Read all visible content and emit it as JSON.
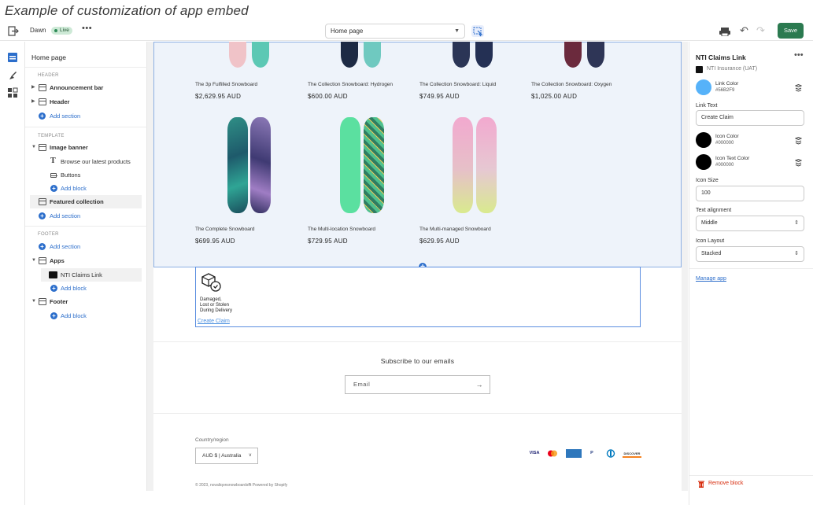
{
  "caption": "Example of customization of app embed",
  "topbar": {
    "theme_name": "Dawn",
    "live_badge": "Live",
    "more": "•••",
    "page_select": "Home page",
    "save_label": "Save"
  },
  "sidebar": {
    "title": "Home page",
    "header_group": "HEADER",
    "announcement_bar": "Announcement bar",
    "header": "Header",
    "add_section": "Add section",
    "template_group": "TEMPLATE",
    "image_banner": "Image banner",
    "browse_text": "Browse our latest products",
    "buttons": "Buttons",
    "add_block": "Add block",
    "featured_collection": "Featured collection",
    "footer_group": "FOOTER",
    "apps": "Apps",
    "nti_claims_link": "NTI Claims Link",
    "footer": "Footer"
  },
  "preview": {
    "products": [
      {
        "name": "The 3p Fulfilled Snowboard",
        "price": "$2,629.95 AUD"
      },
      {
        "name": "The Collection Snowboard: Hydrogen",
        "price": "$600.00 AUD"
      },
      {
        "name": "The Collection Snowboard: Liquid",
        "price": "$749.95 AUD"
      },
      {
        "name": "The Collection Snowboard: Oxygen",
        "price": "$1,025.00 AUD"
      },
      {
        "name": "The Complete Snowboard",
        "price": "$699.95 AUD"
      },
      {
        "name": "The Multi-location Snowboard",
        "price": "$729.95 AUD"
      },
      {
        "name": "The Multi-managed Snowboard",
        "price": "$629.95 AUD"
      }
    ],
    "app_block": {
      "damage_text_1": "Damaged,",
      "damage_text_2": "Lost or Stolen",
      "damage_text_3": "During Delivery",
      "link": "Create Claim"
    },
    "subscribe_title": "Subscribe to our emails",
    "email_placeholder": "Email",
    "country_label": "Country/region",
    "country_value": "AUD $ | Australia",
    "payments": [
      "VISA",
      "MC",
      "AMEX",
      "P",
      "DC",
      "DISCOVER"
    ],
    "copyright": "© 2023, novaliqonsnowboardsfft Powered by Shopify"
  },
  "panel": {
    "title": "NTI Claims Link",
    "subtitle": "NTI Insurance (UAT)",
    "link_color_label": "Link Color",
    "link_color_value": "#56B2F9",
    "link_text_label": "Link Text",
    "link_text_value": "Create Claim",
    "icon_color_label": "Icon Color",
    "icon_color_value": "#000000",
    "icon_text_color_label": "Icon Text Color",
    "icon_text_color_value": "#000000",
    "icon_size_label": "Icon Size",
    "icon_size_value": "100",
    "text_alignment_label": "Text alignment",
    "text_alignment_value": "Middle",
    "icon_layout_label": "Icon Layout",
    "icon_layout_value": "Stacked",
    "manage_app": "Manage app",
    "remove_block": "Remove block"
  },
  "colors": {
    "accent": "#2c6ecb",
    "save_button": "#2b7a50",
    "link_color_swatch": "#56B2F9",
    "icon_color_swatch": "#000000",
    "danger": "#d72c0d"
  },
  "icons": [
    "exit-icon",
    "inspector-icon",
    "device-icon",
    "undo-icon",
    "redo-icon",
    "sections-icon",
    "theme-settings-icon",
    "app-embeds-icon",
    "stack-icon",
    "trash-icon",
    "package-shield-icon",
    "arrow-right-icon"
  ]
}
